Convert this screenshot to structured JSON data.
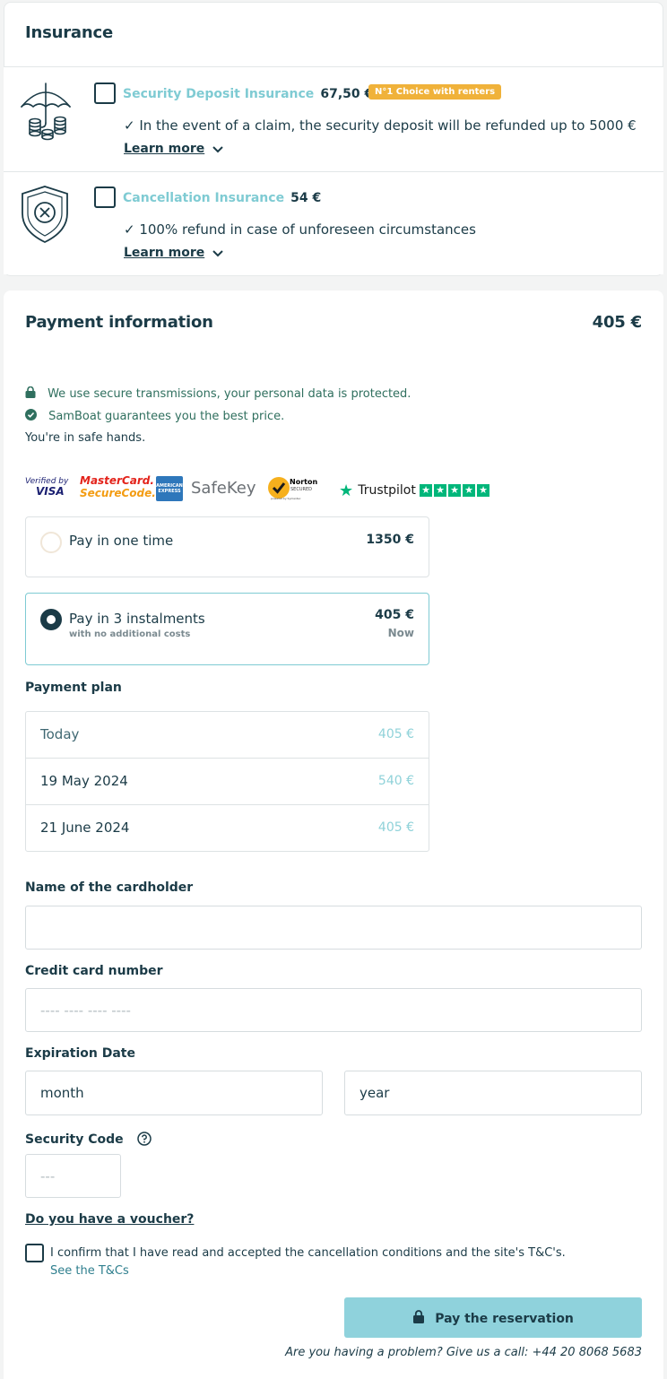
{
  "insurance": {
    "title": "Insurance",
    "items": [
      {
        "name": "Security Deposit Insurance",
        "price": "67,50 €",
        "badge": "N°1 Choice with renters",
        "description": "✓ In the event of a claim, the security deposit will be refunded up to 5000 €",
        "learn_more": "Learn more",
        "icon": "umbrella-coins-icon"
      },
      {
        "name": "Cancellation Insurance",
        "price": "54 €",
        "description": "✓ 100% refund in case of unforeseen circumstances",
        "learn_more": "Learn more",
        "icon": "shield-cross-icon"
      }
    ]
  },
  "payment": {
    "title": "Payment information",
    "total": "405 €",
    "secure_note": "We use secure transmissions, your personal data is protected.",
    "guarantee_note": "SamBoat guarantees you the best price.",
    "safe_hands": "You're in safe hands.",
    "logos": {
      "verified_top": "Verified by",
      "verified_bottom": "VISA",
      "mc_top": "MasterCard.",
      "mc_bottom": "SecureCode.",
      "amex": "AMERICAN EXPRESS",
      "safekey": "SafeKey",
      "norton_top": "Norton",
      "norton_mid": "SECURED",
      "norton_bottom": "powered by Symantec",
      "trustpilot": "Trustpilot"
    },
    "options": [
      {
        "label": "Pay in one time",
        "amount": "1350 €",
        "selected": false
      },
      {
        "label": "Pay in 3 instalments",
        "sublabel": "with no additional costs",
        "amount": "405 €",
        "when": "Now",
        "selected": true
      }
    ],
    "plan_title": "Payment plan",
    "plan": [
      {
        "date": "Today",
        "amount": "405 €"
      },
      {
        "date": "19 May 2024",
        "amount": "540 €"
      },
      {
        "date": "21 June 2024",
        "amount": "405 €"
      }
    ],
    "form": {
      "cardholder_label": "Name of the cardholder",
      "cardholder_value": "",
      "card_number_label": "Credit card number",
      "card_number_placeholder": "---- ---- ---- ----",
      "expiration_label": "Expiration Date",
      "month_value": "month",
      "year_value": "year",
      "security_label": "Security Code",
      "security_placeholder": "---"
    },
    "voucher": "Do you have a voucher?",
    "confirm_text": "I confirm that I have read and accepted the cancellation conditions and the site's T&C's.",
    "see_tc": "See the T&Cs",
    "pay_button": "Pay the reservation",
    "help_text": "Are you having a problem? Give us a call: +44 20 8068 5683"
  },
  "colors": {
    "primary": "#1b3b47",
    "accent": "#7fcbd3",
    "button": "#8fd2dc",
    "badge": "#f0b23a",
    "green": "#2f6f5e"
  }
}
